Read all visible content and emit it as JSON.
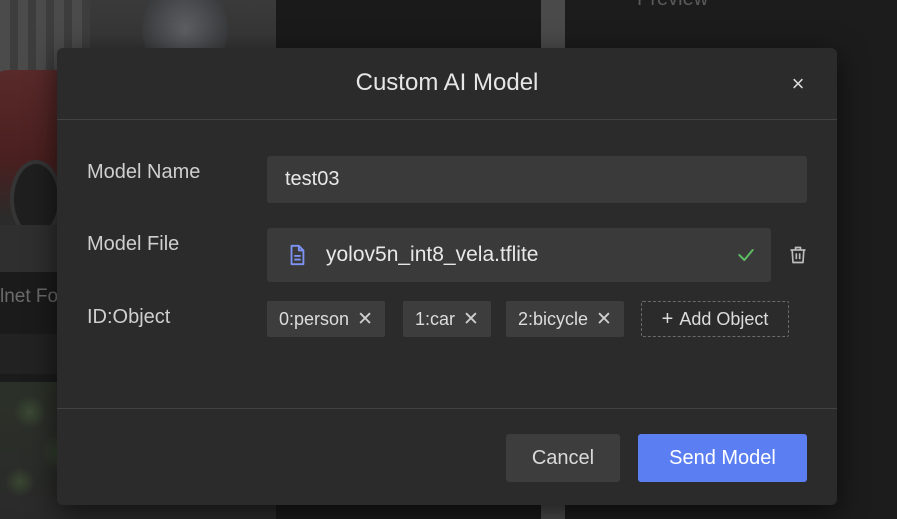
{
  "background": {
    "label_fragment": "lnet Fo",
    "preview_label": "Preview"
  },
  "modal": {
    "title": "Custom AI Model",
    "close_glyph": "×",
    "fields": {
      "model_name": {
        "label": "Model Name",
        "value": "test03"
      },
      "model_file": {
        "label": "Model File",
        "file_name": "yolov5n_int8_vela.tflite",
        "icons": [
          "file-icon",
          "check-icon",
          "trash-icon"
        ],
        "status_color": "#5dbb63"
      },
      "id_object": {
        "label": "ID:Object",
        "tags": [
          {
            "text": "0:person"
          },
          {
            "text": "1:car"
          },
          {
            "text": "2:bicycle"
          }
        ],
        "tag_close_glyph": "✕",
        "add_label": "Add Object",
        "add_glyph": "+"
      }
    },
    "buttons": {
      "cancel": "Cancel",
      "send": "Send Model"
    },
    "colors": {
      "accent": "#5b7ff2",
      "modal_bg": "#2b2b2b",
      "input_bg": "#3a3a3a"
    }
  }
}
